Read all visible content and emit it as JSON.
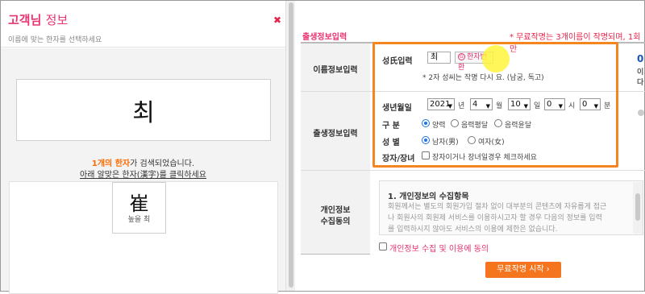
{
  "popup": {
    "title_main": "고객님",
    "title_rest": "정보",
    "subtitle": "이름에 맞는 한자를 선택하세요",
    "close_icon": "close-x",
    "selected_char": "최",
    "result_count": "1개의 한자",
    "result_suffix": "가 검색되었습니다.",
    "click_instruction": "아래 알맞은 한자(漢字)를 클릭하세요",
    "hanja_options": [
      {
        "hanja": "崔",
        "meaning": "높을 최"
      }
    ]
  },
  "form": {
    "section_title": "출생정보입력",
    "free_note": "* 무료작명는 3개이름이 작명되며, 1회만",
    "name_section_label": "이름정보입력",
    "birth_section_label": "출생정보입력",
    "privacy_section_label_1": "개인정보",
    "privacy_section_label_2": "수집동의",
    "surname_label": "성氏입력",
    "surname_value": "최",
    "hanja_button_label": "한자변환",
    "surname_hint": "* 2자 성씨는 작명 다시 요. (남궁, 독고)",
    "birth_label": "생년월일",
    "year_value": "2021",
    "year_unit": "년",
    "month_value": "4",
    "month_unit": "월",
    "day_value": "10",
    "day_unit": "일",
    "hour_value": "0",
    "hour_unit": "시",
    "minute_value": "0",
    "minute_unit": "분",
    "calendar_label": "구 분",
    "calendar_options": [
      "양력",
      "음력평달",
      "음력윤달"
    ],
    "calendar_selected": "양력",
    "gender_label": "성 별",
    "gender_options": [
      "남자(男)",
      "여자(女)"
    ],
    "gender_selected": "남자(男)",
    "eldest_label": "장자/장녀",
    "eldest_text": "장자이거나 장녀일경우 체크하세요",
    "privacy_title": "1. 개인정보의 수집항목",
    "privacy_lines": [
      "회원께서는 별도의 회원가입 절차 없이 대부분의 콘텐츠에 자유롭게 접근",
      "나 회원사의 회원제 서비스를 이용하시고자 할 경우 다음의 정보를 입력",
      "를 입력하시지 않아도 서비스의 이용에 제한은 없습니다."
    ],
    "agree_label": "개인정보 수집 및 이용에 동의",
    "start_button": "무료작명 시작 ›",
    "side_fragments": [
      "0",
      "이",
      "다"
    ]
  },
  "colors": {
    "brand_pink": "#e8346f",
    "highlight_orange": "#f5861f",
    "button_orange": "#f5751f",
    "result_orange": "#ff6a00"
  }
}
